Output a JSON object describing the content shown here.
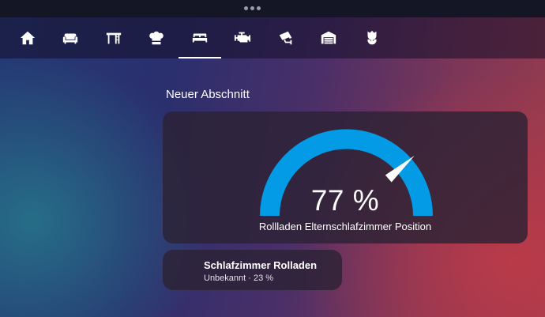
{
  "header": {
    "tabs": [
      {
        "icon": "home-icon"
      },
      {
        "icon": "sofa-icon"
      },
      {
        "icon": "desk-icon"
      },
      {
        "icon": "chef-hat-icon"
      },
      {
        "icon": "bed-icon",
        "active": true
      },
      {
        "icon": "engine-icon"
      },
      {
        "icon": "cctv-icon"
      },
      {
        "icon": "garage-icon"
      },
      {
        "icon": "flower-icon"
      }
    ]
  },
  "section": {
    "title": "Neuer Abschnitt"
  },
  "gauge": {
    "value": 77,
    "display": "77 %",
    "name": "Rollladen Elternschlafzimmer Position",
    "min": 0,
    "max": 100,
    "color": "#039be5"
  },
  "entity": {
    "name": "Schlafzimmer Rolladen",
    "state": "Unbekannt · 23 %"
  }
}
